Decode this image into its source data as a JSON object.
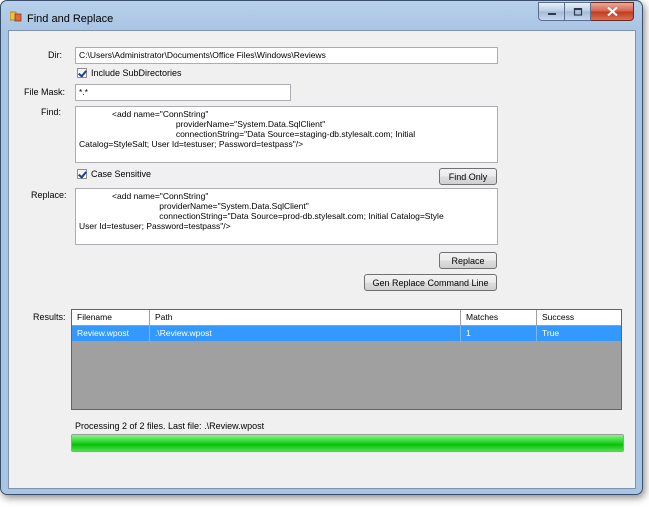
{
  "window": {
    "title": "Find and Replace",
    "caption_buttons": [
      "minimize",
      "maximize",
      "close"
    ]
  },
  "form": {
    "dir_label": "Dir:",
    "dir_value": "C:\\Users\\Administrator\\Documents\\Office Files\\Windows\\Reviews",
    "include_subdirs_label": "Include SubDirectories",
    "include_subdirs_checked": true,
    "file_mask_label": "File Mask:",
    "file_mask_value": "*.*",
    "find_label": "Find:",
    "find_value": "              <add name=\"ConnString\"\n                                         providerName=\"System.Data.SqlClient\"\n                                         connectionString=\"Data Source=staging-db.stylesalt.com; Initial\nCatalog=StyleSalt; User Id=testuser; Password=testpass\"/>",
    "case_sensitive_label": "Case Sensitive",
    "case_sensitive_checked": true,
    "find_only_button": "Find Only",
    "replace_label": "Replace:",
    "replace_value": "              <add name=\"ConnString\"\n                                  providerName=\"System.Data.SqlClient\"\n                                  connectionString=\"Data Source=prod-db.stylesalt.com; Initial Catalog=Style\nUser Id=testuser; Password=testpass\"/>",
    "replace_button": "Replace",
    "gen_command_button": "Gen Replace Command Line"
  },
  "results": {
    "label": "Results:",
    "columns": [
      "Filename",
      "Path",
      "Matches",
      "Success"
    ],
    "rows": [
      [
        "Review.wpost",
        ".\\Review.wpost",
        "1",
        "True"
      ]
    ]
  },
  "status": {
    "text": "Processing 2 of 2 files.  Last file: .\\Review.wpost",
    "progress": 1.0,
    "progress_color": "#0cbf0c"
  },
  "colors": {
    "selection": "#3399ff",
    "grid_background": "#a0a0a0"
  }
}
